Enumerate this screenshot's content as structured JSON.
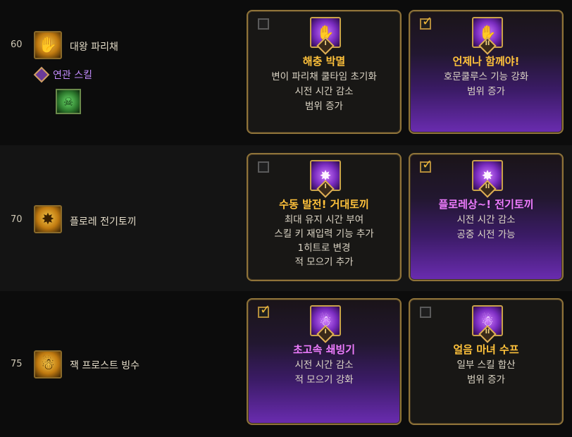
{
  "rows": [
    {
      "level": "60",
      "skill_name": "대왕 파리채",
      "skill_icon": "flyswatter-icon",
      "related_label": "연관 스킬",
      "related_icon": "green-skulls-icon",
      "cards": [
        {
          "checked": false,
          "tier": "I",
          "title": "해충 박멸",
          "title_color": "gold",
          "lines": [
            "변이 파리채 쿨타임 초기화",
            "시전 시간 감소",
            "범위 증가"
          ]
        },
        {
          "checked": true,
          "tier": "II",
          "title": "언제나 함께야!",
          "title_color": "gold",
          "lines": [
            "호문쿨루스 기능 강화",
            "범위 증가"
          ]
        }
      ]
    },
    {
      "level": "70",
      "skill_name": "플로레 전기토끼",
      "skill_icon": "electric-rabbit-icon",
      "cards": [
        {
          "checked": false,
          "tier": "I",
          "title": "수동 발전! 거대토끼",
          "title_color": "gold",
          "lines": [
            "최대 유지 시간 부여",
            "스킬 키 재입력 기능 추가",
            "1히트로 변경",
            "적 모으기 추가"
          ]
        },
        {
          "checked": true,
          "tier": "II",
          "title": "플로레상~! 전기토끼",
          "title_color": "pink",
          "lines": [
            "시전 시간 감소",
            "공중 시전 가능"
          ]
        }
      ]
    },
    {
      "level": "75",
      "skill_name": "잭 프로스트 빙수",
      "skill_icon": "frost-shaved-ice-icon",
      "cards": [
        {
          "checked": true,
          "tier": "I",
          "title": "초고속 쇄빙기",
          "title_color": "pink",
          "lines": [
            "시전 시간 감소",
            "적 모으기 강화"
          ]
        },
        {
          "checked": false,
          "tier": "II",
          "title": "얼음 마녀 수프",
          "title_color": "gold",
          "lines": [
            "일부 스킬 합산",
            "범위 증가"
          ]
        }
      ]
    }
  ]
}
